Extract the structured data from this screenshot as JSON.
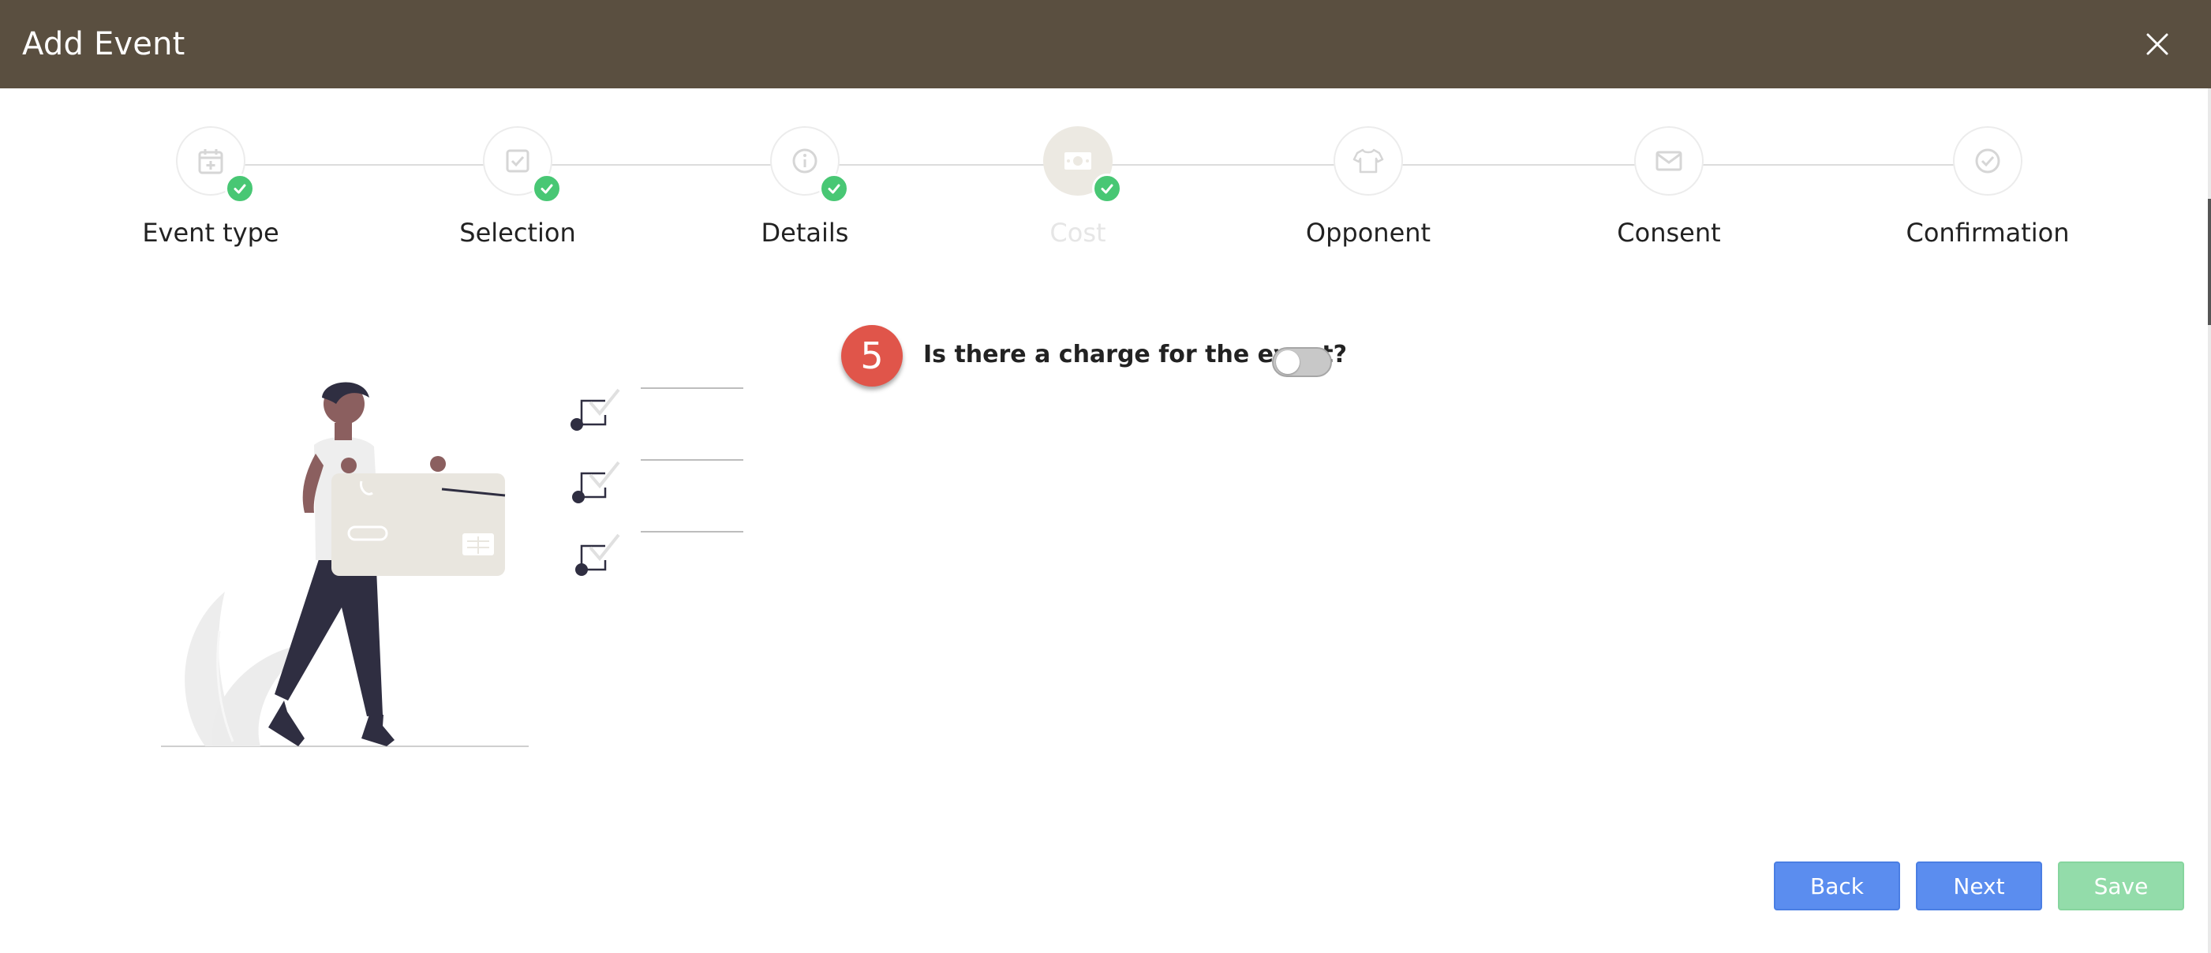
{
  "header": {
    "title": "Add Event"
  },
  "steps": [
    {
      "label": "Event type",
      "icon": "calendar-plus-icon",
      "completed": true
    },
    {
      "label": "Selection",
      "icon": "checkbox-icon",
      "completed": true
    },
    {
      "label": "Details",
      "icon": "info-icon",
      "completed": true
    },
    {
      "label": "Cost",
      "icon": "money-icon",
      "completed": true,
      "active": true
    },
    {
      "label": "Opponent",
      "icon": "tshirt-icon",
      "completed": false
    },
    {
      "label": "Consent",
      "icon": "envelope-icon",
      "completed": false
    },
    {
      "label": "Confirmation",
      "icon": "check-circle-icon",
      "completed": false
    }
  ],
  "question": {
    "step_number": "5",
    "text": "Is there a charge for the event?",
    "toggle_on": false
  },
  "buttons": {
    "back": "Back",
    "next": "Next",
    "save": "Save"
  },
  "colors": {
    "header": "#5a4f40",
    "primary": "#5b8def",
    "success": "#48c774",
    "badge": "#e0554a"
  }
}
